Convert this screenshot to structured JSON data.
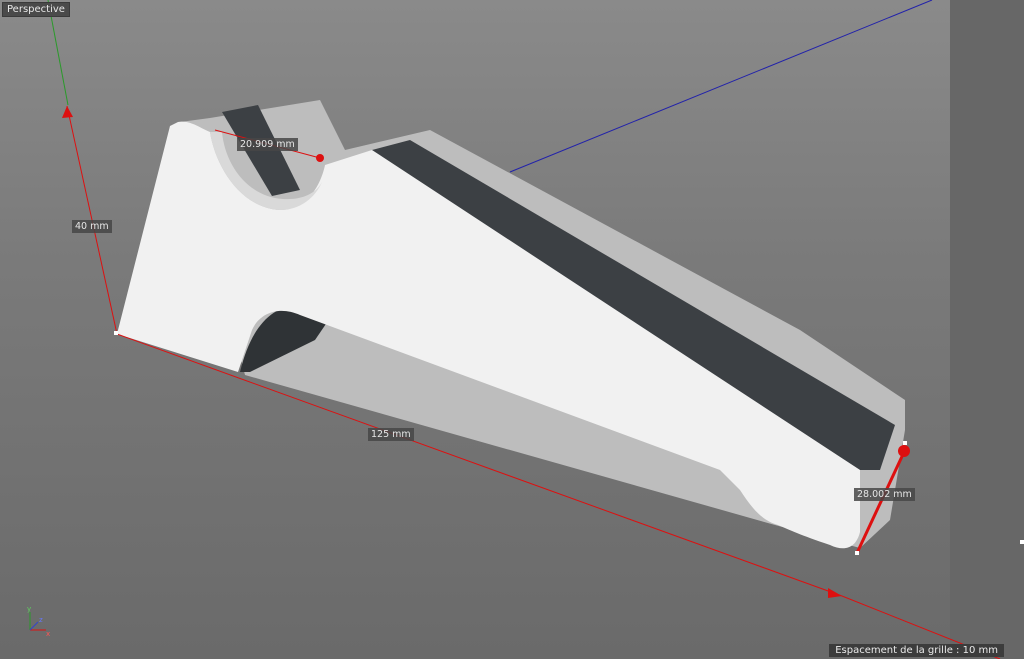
{
  "viewport": {
    "view_name": "Perspective"
  },
  "dimensions": {
    "height": "40 mm",
    "length": "125 mm",
    "radius": "20.909 mm",
    "end_width": "28.002 mm"
  },
  "status": {
    "grid_spacing": "Espacement de la grille : 10 mm"
  },
  "axis_gizmo": {
    "x": "x",
    "y": "y",
    "z": "z"
  },
  "colors": {
    "background_top": "#8a8a8a",
    "background_bottom": "#6a6a6a",
    "model_face": "#f2f2f2",
    "model_side": "#bcbcbc",
    "model_dark_strip": "#3c4044",
    "dimension_line": "#dd1010",
    "y_axis": "#2a9a2a",
    "z_axis": "#2222aa"
  }
}
